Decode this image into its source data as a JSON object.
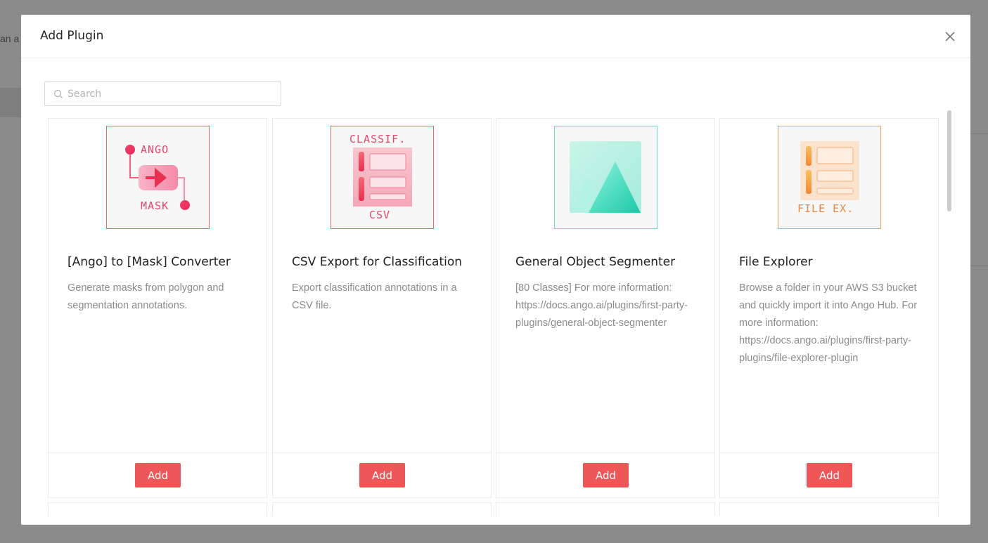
{
  "background": {
    "fragment_text": "an a"
  },
  "modal": {
    "title": "Add Plugin",
    "close_icon": "close-icon"
  },
  "search": {
    "placeholder": "Search",
    "value": "",
    "icon": "search-icon"
  },
  "colors": {
    "accent": "#ef5658",
    "ango_border": "#e8686a",
    "csv_border": "#e8686a",
    "segmenter_border": "#6ed8cf",
    "explorer_border": "#f0a060"
  },
  "plugins": [
    {
      "thumbnail": "ango-to-mask-icon",
      "thumb_text_top": "ANGO",
      "thumb_text_bottom": "MASK",
      "title": "[Ango] to [Mask] Converter",
      "description": "Generate masks from polygon and segmentation annotations.",
      "add_label": "Add"
    },
    {
      "thumbnail": "csv-classification-icon",
      "thumb_text_top": "CLASSIF.",
      "thumb_text_bottom": "CSV",
      "title": "CSV Export for Classification",
      "description": "Export classification annotations in a CSV file.",
      "add_label": "Add"
    },
    {
      "thumbnail": "mountain-image-icon",
      "title": "General Object Segmenter",
      "description": "[80 Classes] For more information: https://docs.ango.ai/plugins/first-party-plugins/general-object-segmenter",
      "add_label": "Add"
    },
    {
      "thumbnail": "file-explorer-icon",
      "thumb_text_bottom": "FILE EX.",
      "title": "File Explorer",
      "description": "Browse a folder in your AWS S3 bucket and quickly import it into Ango Hub. For more information: https://docs.ango.ai/plugins/first-party-plugins/file-explorer-plugin",
      "add_label": "Add"
    }
  ]
}
